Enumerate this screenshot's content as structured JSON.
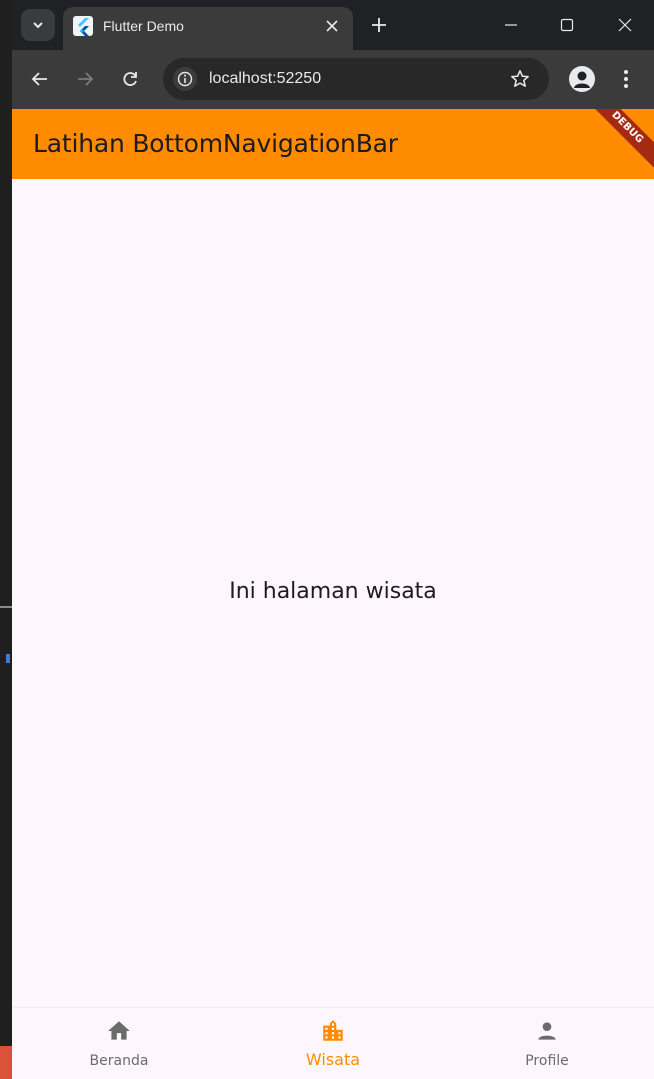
{
  "browser": {
    "tab_title": "Flutter Demo",
    "url": "localhost:52250",
    "icons": {
      "tab_search": "chevron-down-icon",
      "tab_close": "close-icon",
      "new_tab": "plus-icon",
      "minimize": "minimize-icon",
      "maximize": "maximize-icon",
      "close_window": "close-icon",
      "back": "arrow-back-icon",
      "forward": "arrow-forward-icon",
      "reload": "reload-icon",
      "site_info": "info-icon",
      "bookmark": "star-icon",
      "profile": "person-icon",
      "menu": "more-vert-icon"
    }
  },
  "app": {
    "title": "Latihan BottomNavigationBar",
    "debug_banner": "DEBUG",
    "body_text": "Ini halaman wisata",
    "colors": {
      "appbar": "#ff8c00",
      "active": "#ff8c00",
      "inactive": "#6b6b6b",
      "background": "#fdf7fd"
    },
    "nav": {
      "items": [
        {
          "label": "Beranda",
          "icon": "home-icon",
          "active": false
        },
        {
          "label": "Wisata",
          "icon": "location-city-icon",
          "active": true
        },
        {
          "label": "Profile",
          "icon": "person-icon",
          "active": false
        }
      ]
    }
  }
}
